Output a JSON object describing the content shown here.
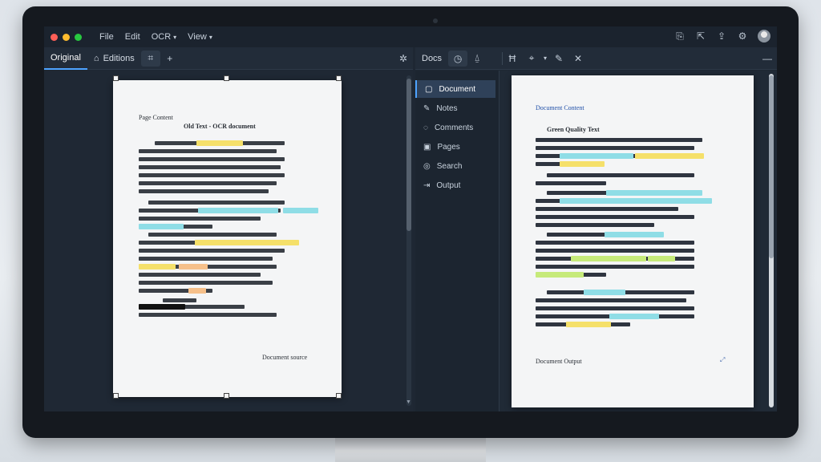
{
  "app": {
    "menu": [
      {
        "label": "File",
        "has_caret": false
      },
      {
        "label": "Edit",
        "has_caret": false
      },
      {
        "label": "OCR",
        "has_caret": true
      },
      {
        "label": "View",
        "has_caret": true
      }
    ],
    "traffic_colors": [
      "#ff5f57",
      "#febc2e",
      "#28c840"
    ],
    "accent": "#4ea3ff"
  },
  "left_toolbar": {
    "tabs": [
      {
        "label": "Original",
        "icon": "none",
        "active": true
      },
      {
        "label": "Editions",
        "icon": "bookmark-icon",
        "active": false
      }
    ]
  },
  "mid_toolbar": {
    "title": "Docs"
  },
  "sidebar": {
    "items": [
      {
        "label": "Document",
        "icon": "document-icon",
        "active": true
      },
      {
        "label": "Notes",
        "icon": "pencil-icon",
        "active": false
      },
      {
        "label": "Comments",
        "icon": "comment-icon",
        "active": false
      },
      {
        "label": "Pages",
        "icon": "pages-icon",
        "active": false
      },
      {
        "label": "Search",
        "icon": "search-icon",
        "active": false
      },
      {
        "label": "Output",
        "icon": "output-icon",
        "active": false
      }
    ]
  },
  "original_page": {
    "header": "Page Content",
    "title": "Old Text - OCR document",
    "footer": "Document source"
  },
  "output_page": {
    "header": "Document Content",
    "subtitle": "Green Quality Text",
    "footer": "Document Output"
  }
}
